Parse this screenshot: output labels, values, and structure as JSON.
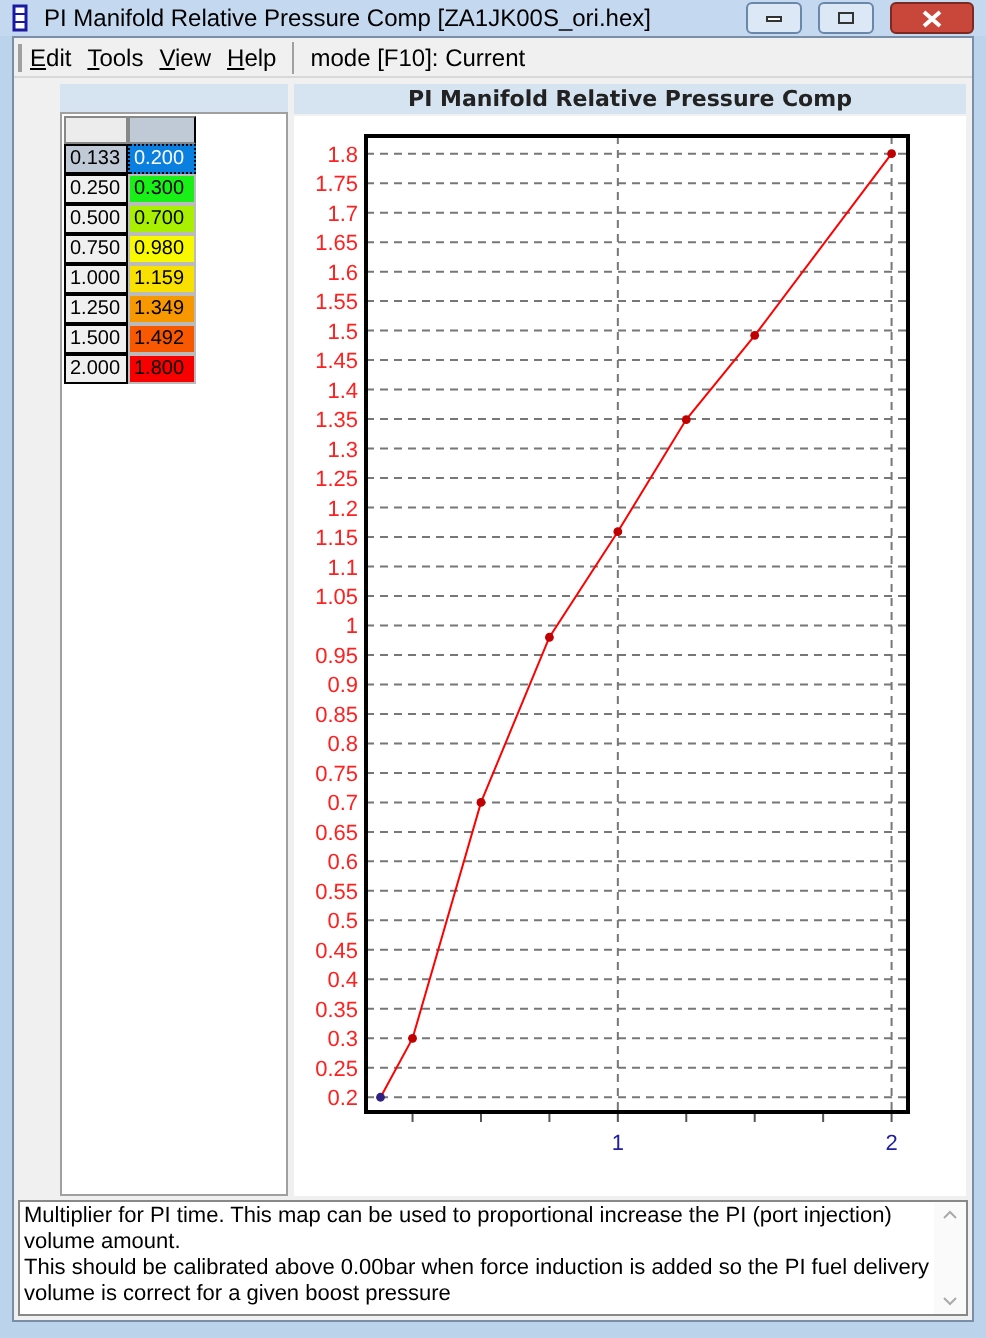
{
  "window": {
    "title": "PI Manifold Relative Pressure Comp [ZA1JK00S_ori.hex]"
  },
  "menu": [
    {
      "label": "Edit"
    },
    {
      "label": "Tools"
    },
    {
      "label": "View"
    },
    {
      "label": "Help"
    }
  ],
  "mode": "mode [F10]: Current",
  "table": {
    "rows": [
      {
        "axis": "0.133",
        "value": "0.200",
        "color": "#0a7fe0",
        "selected": true
      },
      {
        "axis": "0.250",
        "value": "0.300",
        "color": "#18f018",
        "selected": false
      },
      {
        "axis": "0.500",
        "value": "0.700",
        "color": "#a8f000",
        "selected": false
      },
      {
        "axis": "0.750",
        "value": "0.980",
        "color": "#f8f800",
        "selected": false
      },
      {
        "axis": "1.000",
        "value": "1.159",
        "color": "#f8e000",
        "selected": false
      },
      {
        "axis": "1.250",
        "value": "1.349",
        "color": "#f89800",
        "selected": false
      },
      {
        "axis": "1.500",
        "value": "1.492",
        "color": "#f85800",
        "selected": false
      },
      {
        "axis": "2.000",
        "value": "1.800",
        "color": "#f80000",
        "selected": false
      }
    ]
  },
  "chart": {
    "chart_data": {
      "type": "line",
      "title": "PI Manifold Relative Pressure Comp",
      "x": [
        0.133,
        0.25,
        0.5,
        0.75,
        1.0,
        1.25,
        1.5,
        2.0
      ],
      "grid": true,
      "series": [
        {
          "color": "#ff0000",
          "marker": "circle",
          "values": [
            0.2,
            0.3,
            0.7,
            0.98,
            1.159,
            1.349,
            1.492,
            1.8
          ]
        }
      ],
      "xlim": [
        0.08,
        2.06
      ],
      "ylim": [
        0.175,
        1.83
      ],
      "xticks": [
        1,
        2
      ],
      "yticks": [
        0.2,
        0.25,
        0.3,
        0.35,
        0.4,
        0.45,
        0.5,
        0.55,
        0.6,
        0.65,
        0.7,
        0.75,
        0.8,
        0.85,
        0.9,
        0.95,
        1,
        1.05,
        1.1,
        1.15,
        1.2,
        1.25,
        1.3,
        1.35,
        1.4,
        1.45,
        1.5,
        1.55,
        1.6,
        1.65,
        1.7,
        1.75,
        1.8
      ]
    }
  },
  "description": [
    "Multiplier for PI time. This map can be used to proportional increase the PI (port injection) volume amount.",
    "This should be calibrated above 0.00bar when force induction is added so the PI fuel delivery volume is correct for a given boost pressure"
  ]
}
